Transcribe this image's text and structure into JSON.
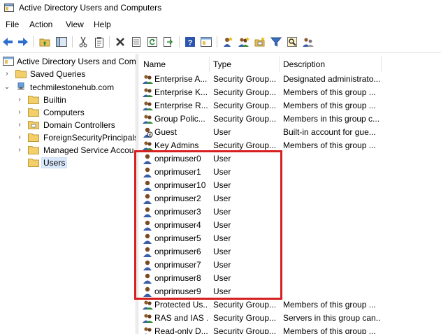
{
  "window": {
    "title": "Active Directory Users and Computers"
  },
  "menubar": [
    "File",
    "Action",
    "View",
    "Help"
  ],
  "toolbar": {
    "buttons": [
      "back-icon",
      "forward-icon",
      "up-folder-icon",
      "show-tree-icon",
      "cut-icon",
      "clipboard-icon",
      "delete-icon",
      "properties-icon",
      "refresh-icon",
      "export-icon",
      "help-icon",
      "console-icon",
      "new-user-icon",
      "new-group-icon",
      "new-ou-icon",
      "filter-icon",
      "find-icon",
      "add-to-group-icon"
    ]
  },
  "tree": {
    "root": "Active Directory Users and Com",
    "saved_queries": "Saved Queries",
    "domain": "techmilestonehub.com",
    "children": [
      "Builtin",
      "Computers",
      "Domain Controllers",
      "ForeignSecurityPrincipals",
      "Managed Service Accou",
      "Users"
    ]
  },
  "list": {
    "columns": [
      "Name",
      "Type",
      "Description"
    ],
    "rows": [
      {
        "name": "Enterprise A...",
        "type": "Security Group...",
        "desc": "Designated administrato...",
        "icon": "group"
      },
      {
        "name": "Enterprise K...",
        "type": "Security Group...",
        "desc": "Members of this group ...",
        "icon": "group"
      },
      {
        "name": "Enterprise R...",
        "type": "Security Group...",
        "desc": "Members of this group ...",
        "icon": "group"
      },
      {
        "name": "Group Polic...",
        "type": "Security Group...",
        "desc": "Members in this group c...",
        "icon": "group"
      },
      {
        "name": "Guest",
        "type": "User",
        "desc": "Built-in account for gue...",
        "icon": "user-disabled"
      },
      {
        "name": "Key Admins",
        "type": "Security Group...",
        "desc": "Members of this group ...",
        "icon": "group"
      },
      {
        "name": "onprimuser0",
        "type": "User",
        "desc": "",
        "icon": "user"
      },
      {
        "name": "onprimuser1",
        "type": "User",
        "desc": "",
        "icon": "user"
      },
      {
        "name": "onprimuser10",
        "type": "User",
        "desc": "",
        "icon": "user"
      },
      {
        "name": "onprimuser2",
        "type": "User",
        "desc": "",
        "icon": "user"
      },
      {
        "name": "onprimuser3",
        "type": "User",
        "desc": "",
        "icon": "user"
      },
      {
        "name": "onprimuser4",
        "type": "User",
        "desc": "",
        "icon": "user"
      },
      {
        "name": "onprimuser5",
        "type": "User",
        "desc": "",
        "icon": "user"
      },
      {
        "name": "onprimuser6",
        "type": "User",
        "desc": "",
        "icon": "user"
      },
      {
        "name": "onprimuser7",
        "type": "User",
        "desc": "",
        "icon": "user"
      },
      {
        "name": "onprimuser8",
        "type": "User",
        "desc": "",
        "icon": "user"
      },
      {
        "name": "onprimuser9",
        "type": "User",
        "desc": "",
        "icon": "user"
      },
      {
        "name": "Protected Us...",
        "type": "Security Group...",
        "desc": "Members of this group ...",
        "icon": "group"
      },
      {
        "name": "RAS and IAS ...",
        "type": "Security Group...",
        "desc": "Servers in this group can...",
        "icon": "group"
      },
      {
        "name": "Read-only D...",
        "type": "Security Group...",
        "desc": "Members of this group ...",
        "icon": "group"
      }
    ]
  },
  "colors": {
    "highlight": "#d62020",
    "selection": "#d9e8fb",
    "folder": "#e8c15a"
  }
}
